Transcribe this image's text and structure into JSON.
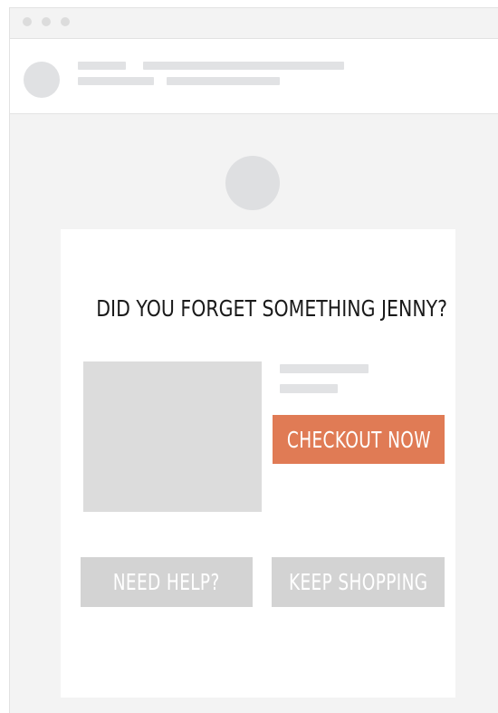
{
  "email": {
    "headline": "DID YOU FORGET SOMETHING JENNY?",
    "checkout_label": "CHECKOUT NOW",
    "help_label": "NEED HELP?",
    "keep_shopping_label": "KEEP SHOPPING"
  },
  "colors": {
    "accent": "#e07b55",
    "secondary_button": "#d3d3d3",
    "placeholder": "#dcdcdc",
    "background": "#f3f3f3"
  },
  "icons": [
    "window-control-dot",
    "sender-avatar",
    "brand-logo-placeholder",
    "product-image-placeholder"
  ]
}
